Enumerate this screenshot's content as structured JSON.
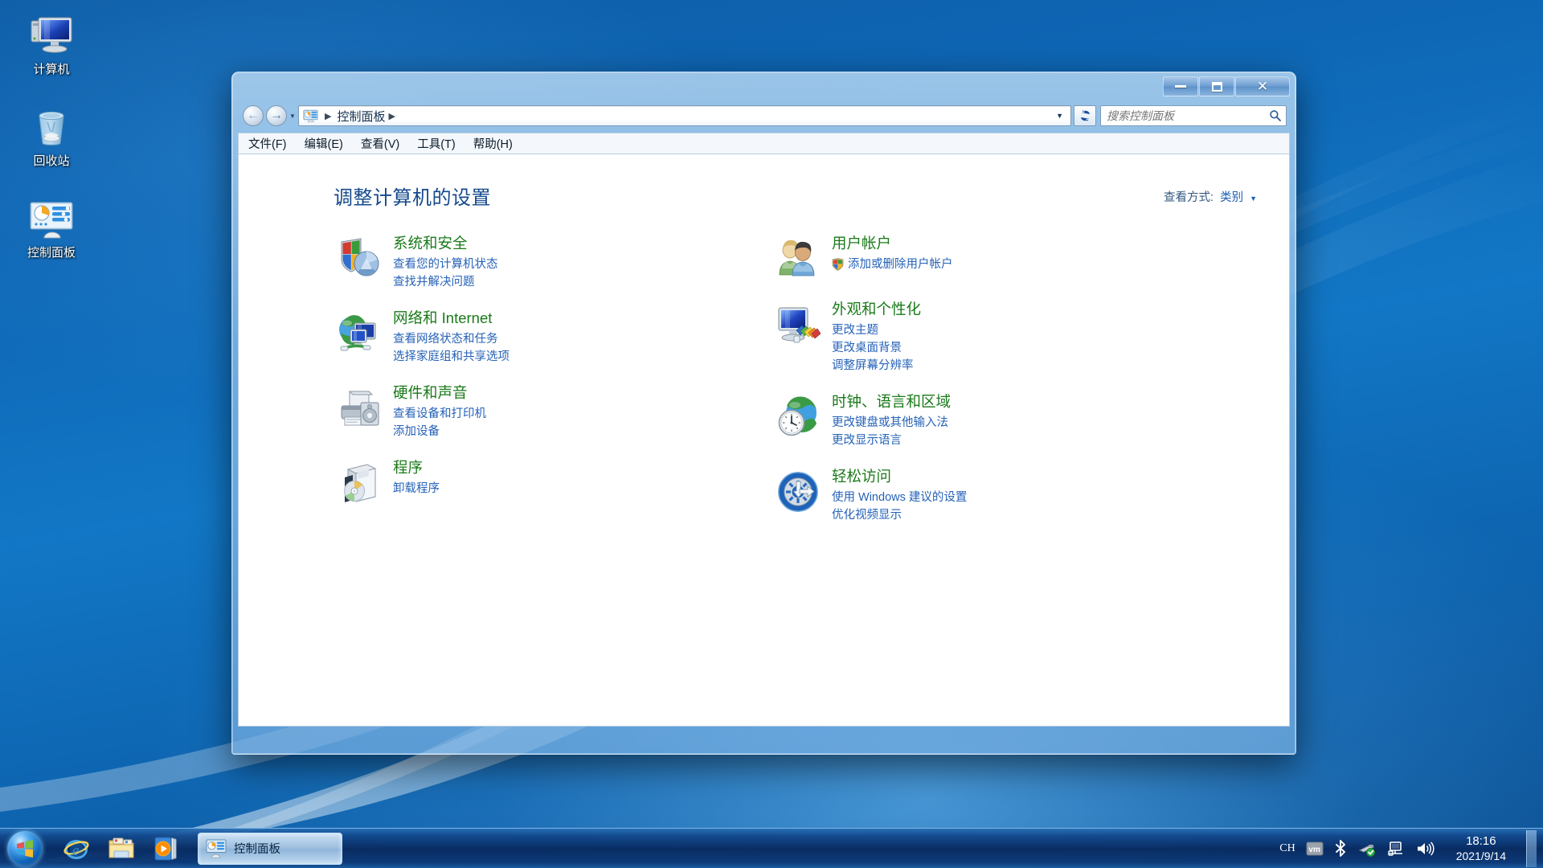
{
  "desktop": {
    "icons": [
      {
        "label": "计算机",
        "icon": "computer-icon"
      },
      {
        "label": "回收站",
        "icon": "recycle-bin-icon"
      },
      {
        "label": "控制面板",
        "icon": "control-panel-icon"
      }
    ]
  },
  "window": {
    "title": "控制面板",
    "controls": {
      "minimize": "最小化",
      "maximize": "最大化",
      "close": "关闭"
    },
    "nav": {
      "back": "后退",
      "forward": "前进",
      "history": "最近浏览的位置"
    },
    "address": {
      "crumb": "控制面板",
      "separator": "▶",
      "refresh": "刷新"
    },
    "search": {
      "placeholder": "搜索控制面板",
      "value": ""
    },
    "menus": [
      {
        "label": "文件(F)"
      },
      {
        "label": "编辑(E)"
      },
      {
        "label": "查看(V)"
      },
      {
        "label": "工具(T)"
      },
      {
        "label": "帮助(H)"
      }
    ]
  },
  "main": {
    "page_title": "调整计算机的设置",
    "view_by": {
      "label": "查看方式:",
      "value": "类别"
    },
    "categories_left": [
      {
        "name": "系统和安全",
        "icon": "shield-pie-icon",
        "links": [
          {
            "text": "查看您的计算机状态",
            "shield": false
          },
          {
            "text": "查找并解决问题",
            "shield": false
          }
        ]
      },
      {
        "name": "网络和 Internet",
        "icon": "globe-network-icon",
        "links": [
          {
            "text": "查看网络状态和任务",
            "shield": false
          },
          {
            "text": "选择家庭组和共享选项",
            "shield": false
          }
        ]
      },
      {
        "name": "硬件和声音",
        "icon": "printer-speaker-icon",
        "links": [
          {
            "text": "查看设备和打印机",
            "shield": false
          },
          {
            "text": "添加设备",
            "shield": false
          }
        ]
      },
      {
        "name": "程序",
        "icon": "software-box-cd-icon",
        "links": [
          {
            "text": "卸载程序",
            "shield": false
          }
        ]
      }
    ],
    "categories_right": [
      {
        "name": "用户帐户",
        "icon": "user-accounts-icon",
        "links": [
          {
            "text": "添加或删除用户帐户",
            "shield": true
          }
        ]
      },
      {
        "name": "外观和个性化",
        "icon": "monitor-palette-icon",
        "links": [
          {
            "text": "更改主题",
            "shield": false
          },
          {
            "text": "更改桌面背景",
            "shield": false
          },
          {
            "text": "调整屏幕分辨率",
            "shield": false
          }
        ]
      },
      {
        "name": "时钟、语言和区域",
        "icon": "globe-clock-icon",
        "links": [
          {
            "text": "更改键盘或其他输入法",
            "shield": false
          },
          {
            "text": "更改显示语言",
            "shield": false
          }
        ]
      },
      {
        "name": "轻松访问",
        "icon": "ease-of-access-icon",
        "links": [
          {
            "text": "使用 Windows 建议的设置",
            "shield": false
          },
          {
            "text": "优化视频显示",
            "shield": false
          }
        ]
      }
    ]
  },
  "taskbar": {
    "start": "开始",
    "quick_launch": [
      {
        "name": "internet-explorer-icon",
        "label": "Internet Explorer"
      },
      {
        "name": "windows-explorer-icon",
        "label": "Windows 资源管理器"
      },
      {
        "name": "windows-media-player-icon",
        "label": "Windows Media Player"
      }
    ],
    "active_task": {
      "label": "控制面板",
      "icon": "control-panel-icon"
    },
    "tray": {
      "ime": "CH",
      "icons": [
        {
          "name": "vmware-tray-icon"
        },
        {
          "name": "bluetooth-icon"
        },
        {
          "name": "safely-remove-hardware-icon"
        },
        {
          "name": "network-icon"
        },
        {
          "name": "volume-icon"
        }
      ]
    },
    "clock": {
      "time": "18:16",
      "date": "2021/9/14"
    }
  },
  "colors": {
    "category_title": "#1a7a1a",
    "link": "#2562b8",
    "page_title": "#15498c",
    "close_button": "#c4341c"
  }
}
